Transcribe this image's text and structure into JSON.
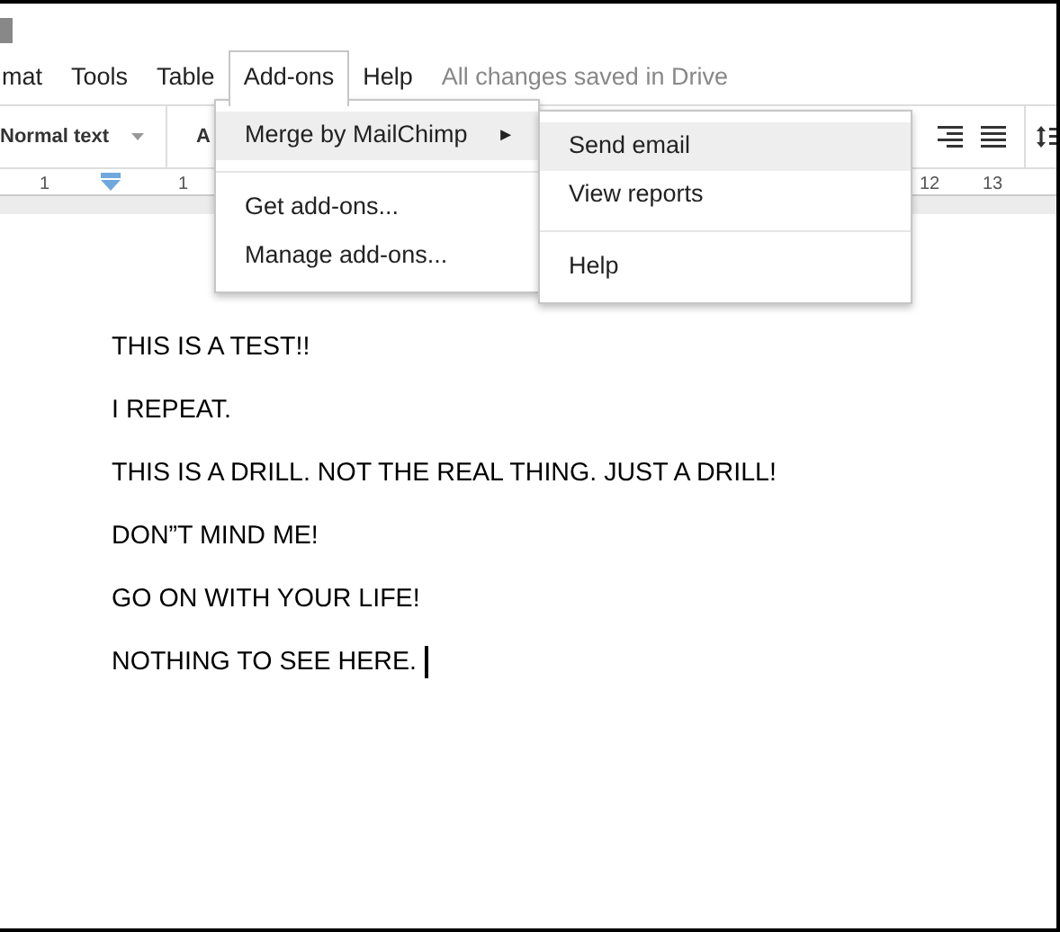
{
  "menubar": {
    "items": [
      {
        "label": "mat",
        "selected": false
      },
      {
        "label": "Tools",
        "selected": false
      },
      {
        "label": "Table",
        "selected": false
      },
      {
        "label": "Add-ons",
        "selected": true
      },
      {
        "label": "Help",
        "selected": false
      }
    ],
    "status": "All changes saved in Drive"
  },
  "toolbar": {
    "style_dropdown": "Normal text",
    "font_dropdown": "A"
  },
  "ruler": {
    "labels": [
      "1",
      "1",
      "12",
      "13"
    ]
  },
  "addons_menu": {
    "groups": [
      [
        {
          "label": "Merge by MailChimp",
          "has_submenu": true,
          "highlighted": true
        }
      ],
      [
        {
          "label": "Get add-ons...",
          "has_submenu": false,
          "highlighted": false
        },
        {
          "label": "Manage add-ons...",
          "has_submenu": false,
          "highlighted": false
        }
      ]
    ],
    "submenu_arrow": "►"
  },
  "submenu": {
    "groups": [
      [
        {
          "label": "Send email",
          "highlighted": true
        },
        {
          "label": "View reports",
          "highlighted": false
        }
      ],
      [
        {
          "label": "Help",
          "highlighted": false
        }
      ]
    ]
  },
  "document": {
    "paragraphs": [
      {
        "text": "THIS IS A TEST!!",
        "cursor": false
      },
      {
        "text": "I REPEAT.",
        "cursor": false
      },
      {
        "text": "THIS IS A DRILL. NOT THE REAL THING. JUST A DRILL!",
        "cursor": false
      },
      {
        "text": "DON”T MIND ME!",
        "cursor": false
      },
      {
        "text": "GO ON WITH YOUR LIFE!",
        "cursor": false
      },
      {
        "text": "NOTHING TO SEE HERE.",
        "cursor": true
      }
    ]
  }
}
